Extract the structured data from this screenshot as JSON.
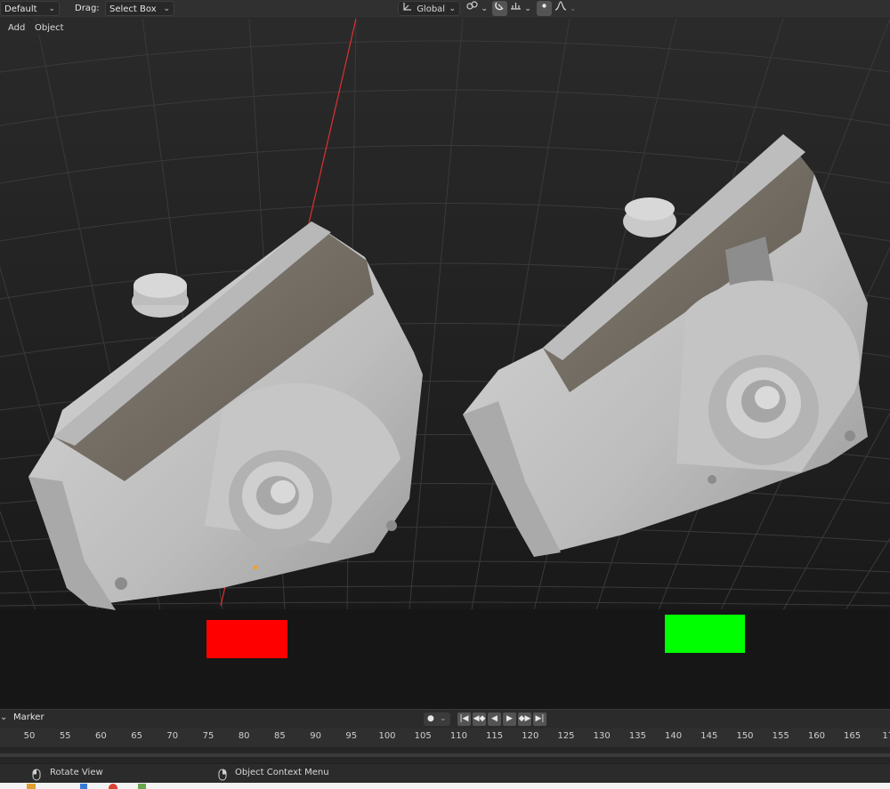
{
  "header": {
    "mode_value": "Default",
    "drag_label": "Drag:",
    "drag_value": "Select Box",
    "transform_orientation": "Global"
  },
  "viewport": {
    "menu": [
      "Add",
      "Object"
    ],
    "left_marker_color": "#ff0000",
    "right_marker_color": "#00ff00",
    "x_axis_color": "#e03030"
  },
  "timeline": {
    "marker_label": "Marker",
    "ticks": [
      "50",
      "55",
      "60",
      "65",
      "70",
      "75",
      "80",
      "85",
      "90",
      "95",
      "100",
      "105",
      "110",
      "115",
      "120",
      "125",
      "130",
      "135",
      "140",
      "145",
      "150",
      "155",
      "160",
      "165",
      "17"
    ]
  },
  "status": {
    "left_action": "Rotate View",
    "right_action": "Object Context Menu"
  }
}
